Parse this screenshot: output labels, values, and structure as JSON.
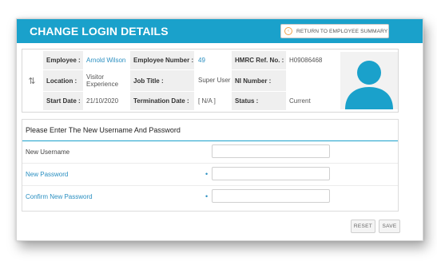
{
  "header": {
    "title": "CHANGE LOGIN DETAILS",
    "return_button": "RETURN TO EMPLOYEE SUMMARY"
  },
  "employee": {
    "employee_label": "Employee :",
    "employee_value": "Arnold Wilson",
    "employee_number_label": "Employee Number :",
    "employee_number_value": "49",
    "hmrc_label": "HMRC Ref. No. :",
    "hmrc_value": "H09086468",
    "location_label": "Location :",
    "location_value": "Visitor Experience",
    "job_title_label": "Job Title :",
    "job_title_value": "Super User",
    "ni_label": "NI Number :",
    "ni_value": "",
    "start_date_label": "Start Date :",
    "start_date_value": "21/10/2020",
    "termination_label": "Termination Date :",
    "termination_value": "[ N/A ]",
    "status_label": "Status :",
    "status_value": "Current"
  },
  "form": {
    "heading": "Please Enter The New Username And Password",
    "username_label": "New Username",
    "username_value": "",
    "password_label": "New Password",
    "password_value": "",
    "confirm_label": "Confirm New Password",
    "confirm_value": "",
    "required_marker": "•"
  },
  "buttons": {
    "reset": "RESET",
    "save": "SAVE"
  },
  "colors": {
    "accent": "#1aa1cb",
    "link": "#2a8fc1",
    "return_icon": "#f0a24b"
  },
  "icons": {
    "sort": "sort-arrows-icon",
    "return": "circle-left-arrow-icon",
    "avatar": "user-silhouette-icon"
  }
}
